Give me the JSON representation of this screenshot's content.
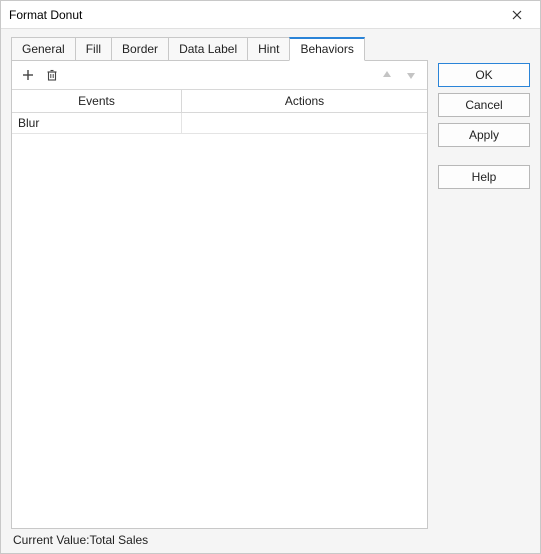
{
  "window": {
    "title": "Format Donut"
  },
  "tabs": [
    {
      "label": "General"
    },
    {
      "label": "Fill"
    },
    {
      "label": "Border"
    },
    {
      "label": "Data Label"
    },
    {
      "label": "Hint"
    },
    {
      "label": "Behaviors",
      "active": true
    }
  ],
  "grid": {
    "columns": {
      "events": "Events",
      "actions": "Actions"
    },
    "rows": [
      {
        "event": "Blur",
        "action": ""
      }
    ]
  },
  "footer": {
    "label": "Current Value:",
    "value": "Total Sales"
  },
  "buttons": {
    "ok": "OK",
    "cancel": "Cancel",
    "apply": "Apply",
    "help": "Help"
  }
}
